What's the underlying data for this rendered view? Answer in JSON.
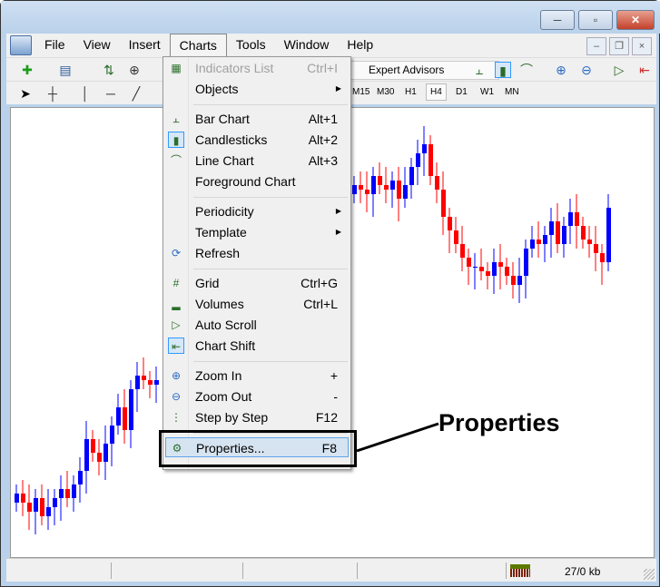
{
  "window": {
    "buttons": {
      "minimize": "─",
      "maximize": "▫",
      "close": "✕"
    },
    "mdi": {
      "minimize": "–",
      "restore": "❐",
      "close": "×"
    }
  },
  "menubar": [
    "File",
    "View",
    "Insert",
    "Charts",
    "Tools",
    "Window",
    "Help"
  ],
  "toolbar": {
    "expert_advisors": "Expert Advisors",
    "timeframes": [
      "M15",
      "M30",
      "H1",
      "H4",
      "D1",
      "W1",
      "MN"
    ],
    "active_timeframe": "H4"
  },
  "menu": {
    "items": [
      {
        "label": "Indicators List",
        "shortcut": "Ctrl+I",
        "disabled": true,
        "icon": "indicators-list-icon"
      },
      {
        "label": "Objects",
        "submenu": true
      },
      {
        "label": "Bar Chart",
        "shortcut": "Alt+1",
        "icon": "bar-chart-icon"
      },
      {
        "label": "Candlesticks",
        "shortcut": "Alt+2",
        "icon": "candlesticks-icon",
        "checked": true
      },
      {
        "label": "Line Chart",
        "shortcut": "Alt+3",
        "icon": "line-chart-icon"
      },
      {
        "label": "Foreground Chart"
      },
      {
        "label": "Periodicity",
        "submenu": true
      },
      {
        "label": "Template",
        "submenu": true
      },
      {
        "label": "Refresh",
        "icon": "refresh-icon"
      },
      {
        "label": "Grid",
        "shortcut": "Ctrl+G",
        "icon": "grid-icon"
      },
      {
        "label": "Volumes",
        "shortcut": "Ctrl+L",
        "icon": "volumes-icon"
      },
      {
        "label": "Auto Scroll",
        "icon": "auto-scroll-icon"
      },
      {
        "label": "Chart Shift",
        "icon": "chart-shift-icon",
        "checked": true
      },
      {
        "label": "Zoom In",
        "shortcut": "+",
        "icon": "zoom-in-icon"
      },
      {
        "label": "Zoom Out",
        "shortcut": "-",
        "icon": "zoom-out-icon"
      },
      {
        "label": "Step by Step",
        "shortcut": "F12",
        "icon": "step-by-step-icon"
      },
      {
        "label": "Properties...",
        "shortcut": "F8",
        "icon": "properties-icon",
        "highlighted": true
      }
    ]
  },
  "callout": "Properties",
  "status": {
    "traffic": "27/0 kb"
  },
  "colors": {
    "bull": "#0000ff",
    "bear": "#ff0000"
  },
  "chart": {
    "candles_left_closes": [
      14,
      12,
      10,
      13,
      9,
      11,
      13,
      15,
      13,
      16,
      19,
      26,
      23,
      21,
      25,
      29,
      33,
      28,
      37,
      40,
      39,
      38,
      39
    ],
    "candles_right_closes": [
      82,
      81,
      80,
      84,
      82,
      81,
      83,
      79,
      82,
      86,
      89,
      91,
      84,
      81,
      75,
      72,
      69,
      66,
      64,
      64,
      63,
      62,
      65,
      64,
      62,
      60,
      62,
      68,
      70,
      69,
      71,
      74,
      69,
      73,
      76,
      73,
      70,
      69,
      67,
      65,
      77
    ]
  }
}
